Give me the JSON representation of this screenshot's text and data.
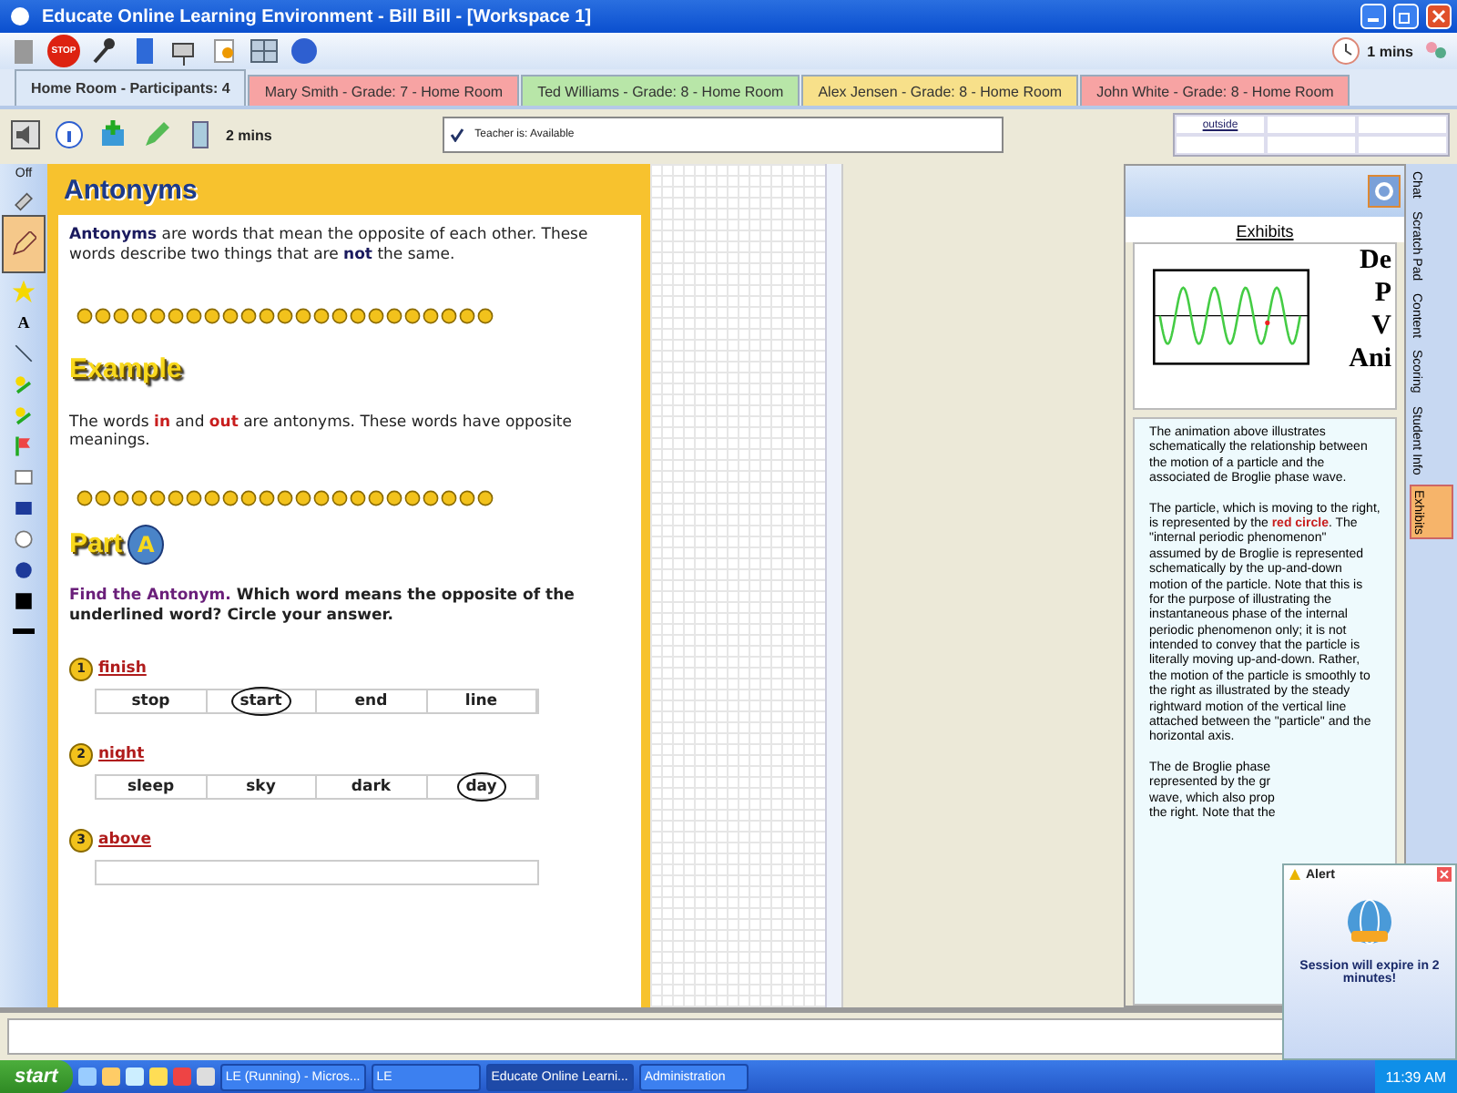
{
  "window": {
    "title": "Educate Online Learning Environment - Bill Bill - [Workspace 1]"
  },
  "toolbar": {
    "stop_label": "STOP",
    "timer": "1 mins"
  },
  "tabs": [
    {
      "label": "Home Room - Participants: 4",
      "selected": true,
      "color": "#dce8f7"
    },
    {
      "label": "Mary Smith - Grade: 7 - Home Room",
      "selected": false,
      "color": "#f7a3a3"
    },
    {
      "label": "Ted Williams - Grade: 8 - Home Room",
      "selected": false,
      "color": "#b8e6a8"
    },
    {
      "label": "Alex Jensen - Grade: 8 - Home Room",
      "selected": false,
      "color": "#f7e08a"
    },
    {
      "label": "John White - Grade: 8 - Home Room",
      "selected": false,
      "color": "#f7a3a3"
    }
  ],
  "session_toolbar": {
    "timer": "2 mins",
    "status": "Teacher is: Available",
    "grid_link": "outside"
  },
  "tools": {
    "off_label": "Off",
    "items": [
      {
        "kind": "eraser",
        "selected": false
      },
      {
        "kind": "pencil",
        "selected": true
      },
      {
        "kind": "star",
        "selected": false
      },
      {
        "kind": "text",
        "label": "A",
        "selected": false
      },
      {
        "kind": "line",
        "selected": false
      },
      {
        "kind": "stamp",
        "selected": false
      },
      {
        "kind": "stamp",
        "selected": false
      },
      {
        "kind": "flag",
        "selected": false
      },
      {
        "kind": "rect",
        "selected": false
      },
      {
        "kind": "filled-rect",
        "selected": false
      },
      {
        "kind": "circle",
        "selected": false
      },
      {
        "kind": "filled-circle",
        "selected": false
      },
      {
        "kind": "color",
        "selected": false
      },
      {
        "kind": "width",
        "selected": false
      }
    ]
  },
  "worksheet": {
    "title": "Antonyms",
    "intro": "**Antonyms** are words that mean the opposite of each other. These words describe two things that are **not** the same.",
    "example_heading": "Example",
    "example": "The words **in** and **out** are antonyms. These words have opposite meanings.",
    "part_label": "Part",
    "part_letter": "A",
    "instruction_lead": "Find the Antonym.",
    "instruction": "Which word means the opposite of the underlined word? Circle your answer.",
    "questions": [
      {
        "number": "1",
        "word": "finish",
        "options": [
          {
            "text": "stop",
            "selected": false
          },
          {
            "text": "start",
            "selected": true
          },
          {
            "text": "end",
            "selected": false
          },
          {
            "text": "line",
            "selected": false
          }
        ]
      },
      {
        "number": "2",
        "word": "night",
        "options": [
          {
            "text": "sleep",
            "selected": false
          },
          {
            "text": "sky",
            "selected": false
          },
          {
            "text": "dark",
            "selected": false
          },
          {
            "text": "day",
            "selected": true
          }
        ]
      },
      {
        "number": "3",
        "word": "above"
      }
    ]
  },
  "exhibits": {
    "title": "Exhibits",
    "fragments": [
      "De",
      "P",
      "V",
      "Ani"
    ],
    "paragraphs": [
      "The animation above illustrates schematically the relationship between the motion of a particle and the associated de Broglie phase wave.",
      "The particle, which is moving to the right, is represented by the **red circle**. The \"internal periodic phenomenon\" assumed by de Broglie is represented schematically by the up-and-down motion of the particle. Note that this is for the purpose of illustrating the instantaneous phase of the internal periodic phenomenon only; it is not intended to convey that the particle is literally moving up-and-down. Rather, the motion of the particle is smoothly to the right as illustrated by the steady rightward motion of the vertical line attached between the \"particle\" and the horizontal axis.",
      "The de Broglie phase represented by the gr wave, which also prop the right. Note that the"
    ]
  },
  "side_tabs": [
    {
      "label": "Chat",
      "selected": false
    },
    {
      "label": "Scratch Pad",
      "selected": false
    },
    {
      "label": "Content",
      "selected": false
    },
    {
      "label": "Scoring",
      "selected": false
    },
    {
      "label": "Student Info",
      "selected": false
    },
    {
      "label": "Exhibits",
      "selected": true
    }
  ],
  "alert": {
    "title": "Alert",
    "message": "Session will expire in 2 minutes!"
  },
  "taskbar": {
    "start": "start",
    "tasks": [
      {
        "label": "LE (Running) - Micros...",
        "selected": false
      },
      {
        "label": "LE",
        "selected": false
      },
      {
        "label": "Educate Online Learni...",
        "selected": true
      },
      {
        "label": "Administration",
        "selected": false
      }
    ],
    "clock": "11:39 AM"
  }
}
